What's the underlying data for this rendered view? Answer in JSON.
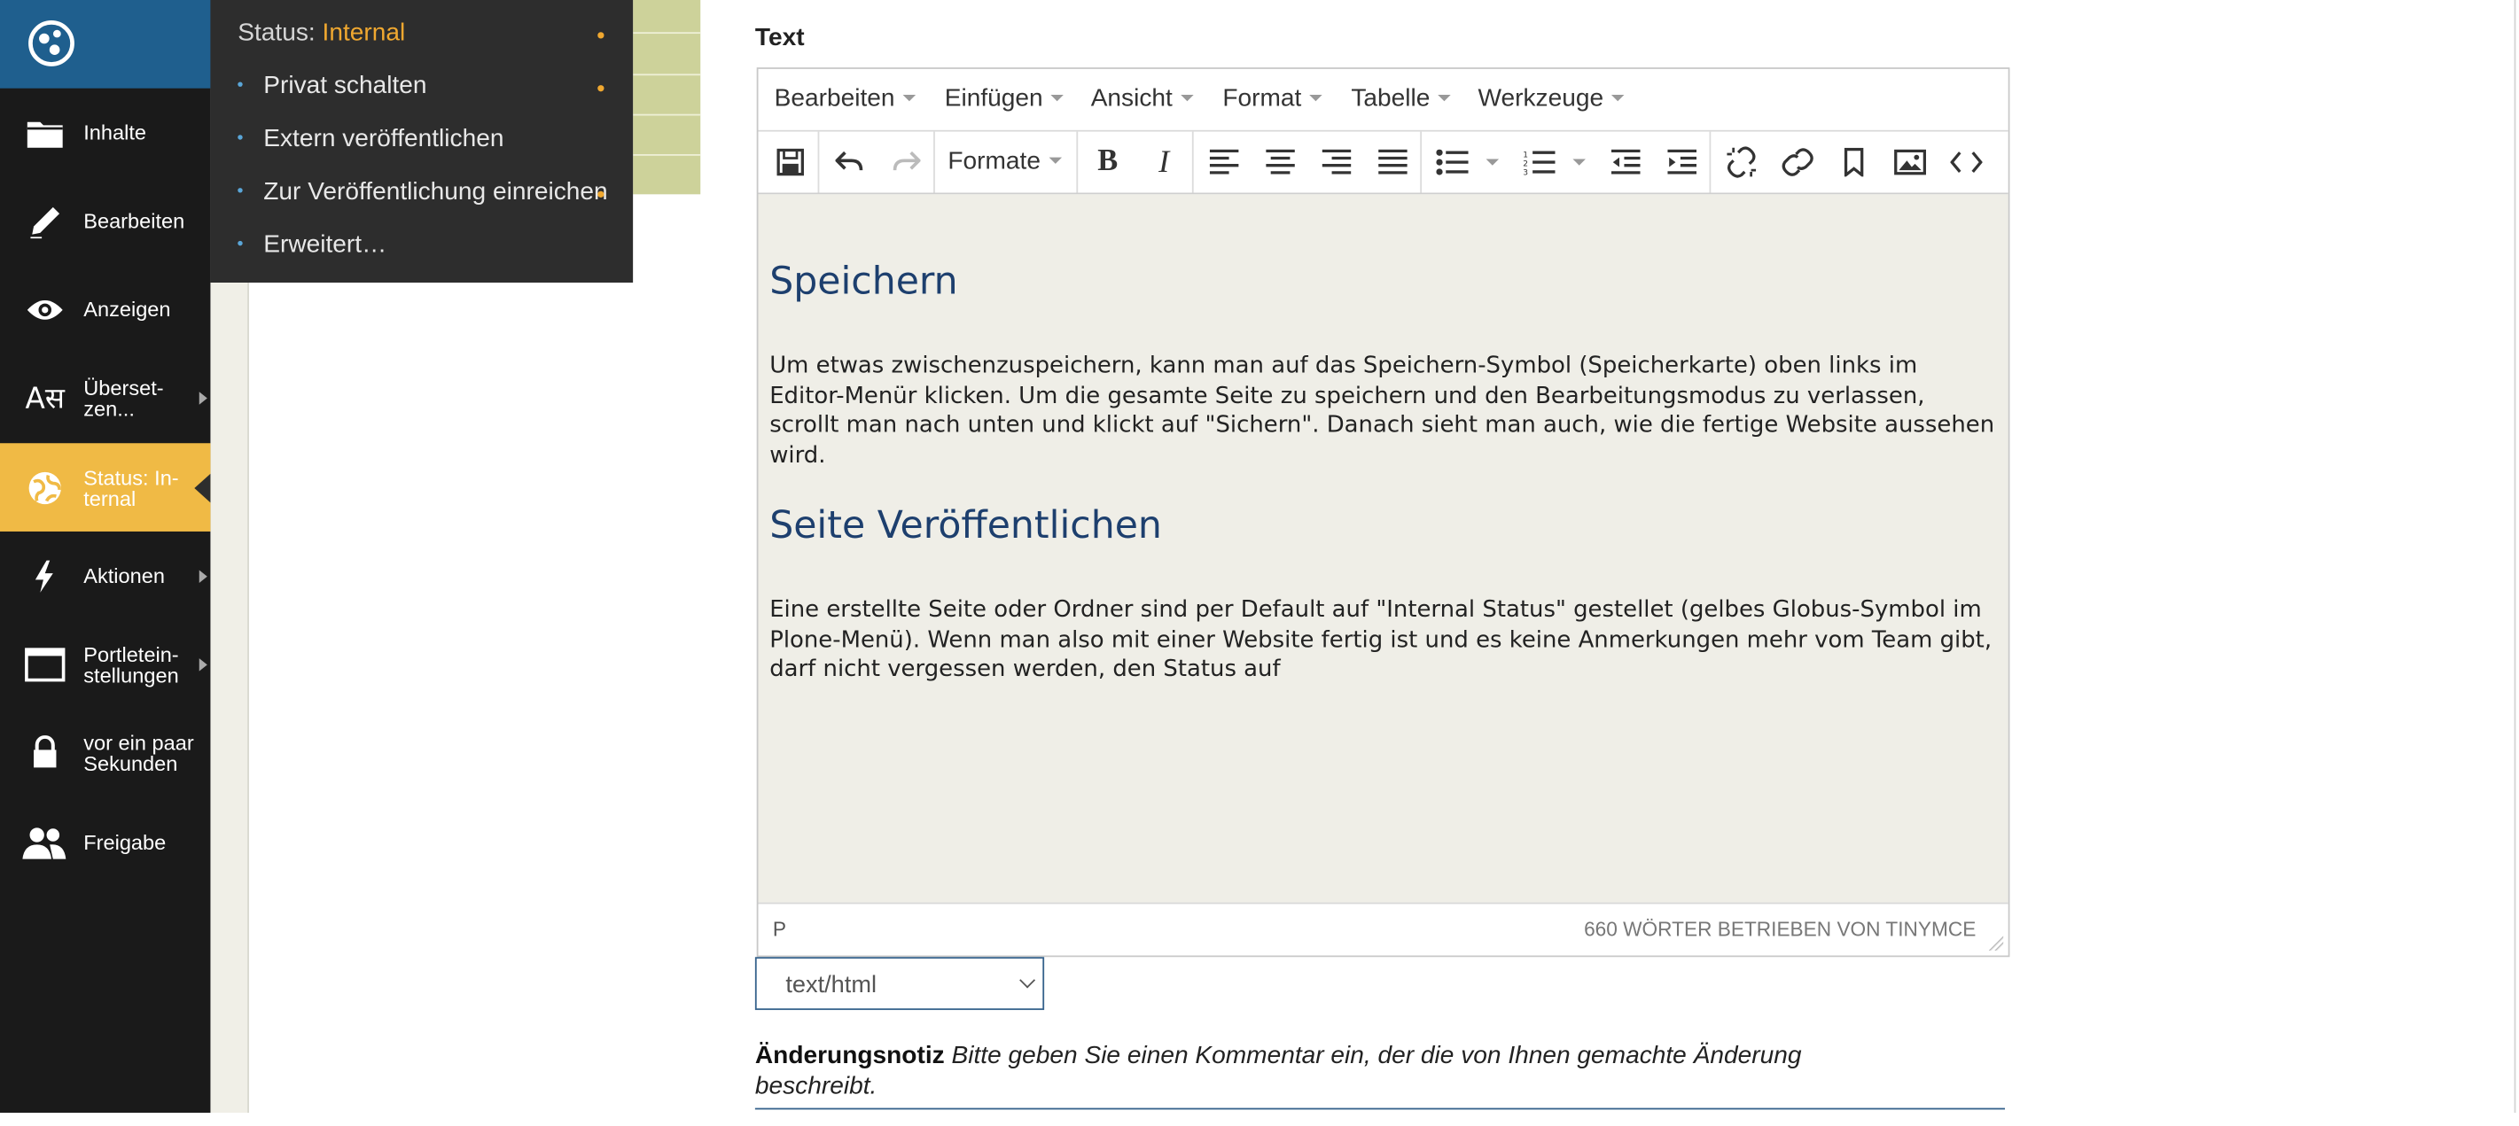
{
  "toolbar": {
    "items": [
      {
        "label": "Inhalte",
        "icon": "folder-icon"
      },
      {
        "label": "Bearbeiten",
        "icon": "pencil-icon"
      },
      {
        "label": "Anzeigen",
        "icon": "eye-icon"
      },
      {
        "label": "Überset-zen...",
        "icon": "translate-icon"
      },
      {
        "label": "Status: In-ternal",
        "icon": "globe-icon"
      },
      {
        "label": "Aktionen",
        "icon": "lightning-icon"
      },
      {
        "label": "Portletein-stellungen",
        "icon": "window-icon"
      },
      {
        "label": "vor ein paar Sekunden",
        "icon": "lock-icon"
      },
      {
        "label": "Freigabe",
        "icon": "users-icon"
      }
    ]
  },
  "status_menu": {
    "header_prefix": "Status:",
    "header_value": "Internal",
    "items": [
      "Privat schalten",
      "Extern veröffentlichen",
      "Zur Veröffentlichung einreichen",
      "Erweitert…"
    ]
  },
  "editor": {
    "field_label": "Text",
    "menus": [
      "Bearbeiten",
      "Einfügen",
      "Ansicht",
      "Format",
      "Tabelle",
      "Werkzeuge"
    ],
    "formats_label": "Formate",
    "heading1": "Speichern",
    "para1": "Um etwas zwischenzuspeichern, kann man auf das Speichern-Symbol (Speicherkarte) oben links im Editor-Menür klicken. Um die gesamte Seite zu speichern und den Bearbeitungsmodus zu verlassen, scrollt man nach unten und klickt auf \"Sichern\". Danach sieht man auch, wie die fertige Website aussehen wird.",
    "heading2": "Seite Veröffentlichen",
    "para2": "Eine erstellte Seite oder Ordner sind per Default auf \"Internal Status\" gestellet (gelbes Globus-Symbol im Plone-Menü). Wenn man also mit einer Website fertig ist und es keine Anmerkungen mehr vom Team gibt, darf nicht vergessen werden, den Status auf",
    "path": "P",
    "wordcount": "660 WÖRTER BETRIEBEN VON TINYMCE"
  },
  "format_select": {
    "value": "text/html"
  },
  "change_note": {
    "label": "Änderungsnotiz",
    "help": "Bitte geben Sie einen Kommentar ein, der die von Ihnen gemachte Änderung beschreibt."
  },
  "colors": {
    "toolbar_bg": "#1a1a1a",
    "logo_bg": "#1f5f8e",
    "active_status": "#f0ba45",
    "internal_accent": "#f0a830",
    "heading_color": "#1d3f6e"
  }
}
